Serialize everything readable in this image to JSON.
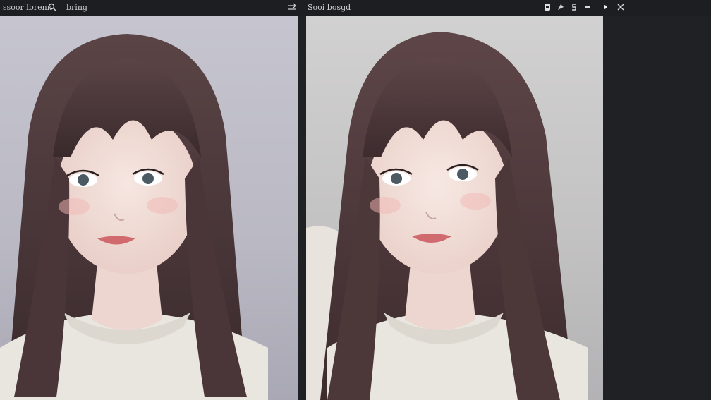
{
  "toolbar": {
    "left_label": "ssoor lbrenn",
    "left_label2": "bring",
    "center_label": "Sooi bosgd",
    "icons_left": [
      "search-icon",
      "export-arrow-icon"
    ],
    "icons_right": [
      "copy-icon",
      "brush-icon",
      "dollar-icon",
      "minimize-icon",
      "toggle-icon",
      "close-icon"
    ]
  },
  "panels": [
    {
      "name": "original-image",
      "icon": "portrait-image"
    },
    {
      "name": "processed-image",
      "icon": "portrait-image"
    }
  ],
  "colors": {
    "toolbar_bg": "#1c1e21",
    "app_bg": "#1f2124",
    "hair": "#4a3638",
    "skin": "#f1dcd6",
    "sweater": "#e9e5df"
  }
}
